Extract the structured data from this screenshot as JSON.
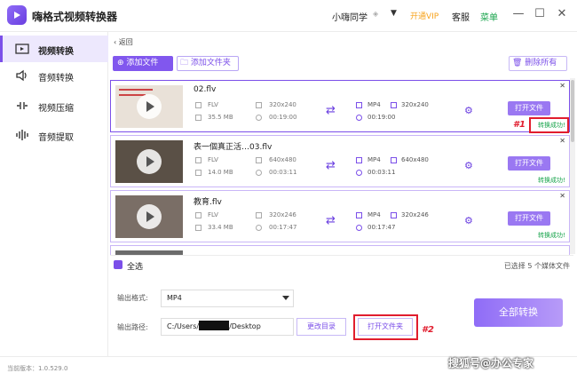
{
  "app": {
    "title": "嗨格式视频转换器"
  },
  "header": {
    "user": "小嗨同学",
    "vip": "开通VIP",
    "service": "客服",
    "menu": "菜单"
  },
  "sidebar": {
    "items": [
      {
        "label": "视频转换",
        "icon": "video-convert-icon",
        "active": true
      },
      {
        "label": "音频转换",
        "icon": "audio-icon",
        "active": false
      },
      {
        "label": "视频压缩",
        "icon": "compress-icon",
        "active": false
      },
      {
        "label": "音频提取",
        "icon": "extract-icon",
        "active": false
      }
    ]
  },
  "toolbar": {
    "back": "返回",
    "add_file": "添加文件",
    "add_folder": "添加文件夹",
    "delete_all": "删除所有"
  },
  "files": [
    {
      "name": "02.flv",
      "in_format": "FLV",
      "in_res": "320x240",
      "in_size": "35.5 MB",
      "in_duration": "00:19:00",
      "out_format": "MP4",
      "out_res": "320x240",
      "out_duration": "00:19:00",
      "open_label": "打开文件",
      "status": "转换成功!"
    },
    {
      "name": "表一個真正活…03.flv",
      "in_format": "FLV",
      "in_res": "640x480",
      "in_size": "14.0 MB",
      "in_duration": "00:03:11",
      "out_format": "MP4",
      "out_res": "640x480",
      "out_duration": "00:03:11",
      "open_label": "打开文件",
      "status": "转换成功!"
    },
    {
      "name": "教育.flv",
      "in_format": "FLV",
      "in_res": "320x246",
      "in_size": "33.4 MB",
      "in_duration": "00:17:47",
      "out_format": "MP4",
      "out_res": "320x246",
      "out_duration": "00:17:47",
      "open_label": "打开文件",
      "status": "转换成功!"
    },
    {
      "name": "",
      "in_format": "",
      "in_res": "",
      "in_size": "",
      "in_duration": "",
      "out_format": "",
      "out_res": "",
      "out_duration": "",
      "open_label": "",
      "status": ""
    }
  ],
  "annotations": {
    "mark1": "#1",
    "mark2": "#2"
  },
  "bottom": {
    "select_all": "全选",
    "selected_count": "已选择 5 个媒体文件",
    "output_format_label": "输出格式:",
    "output_format": "MP4",
    "output_path_label": "输出路径:",
    "path_prefix": "C:/Users/",
    "path_suffix": "/Desktop",
    "change_dir": "更改目录",
    "open_folder": "打开文件夹",
    "convert_all": "全部转换"
  },
  "status": {
    "version": "当前版本：1.0.529.0"
  },
  "watermark": "搜狐号@办公专家"
}
